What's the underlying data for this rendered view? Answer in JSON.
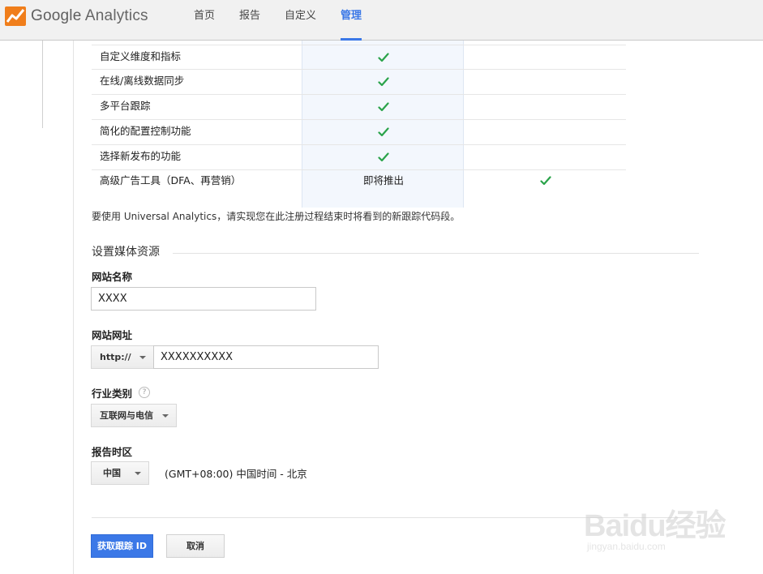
{
  "header": {
    "logo_google": "Google",
    "logo_product": "Analytics",
    "nav": [
      {
        "label": "首页",
        "active": false
      },
      {
        "label": "报告",
        "active": false
      },
      {
        "label": "自定义",
        "active": false
      },
      {
        "label": "管理",
        "active": true
      }
    ],
    "accent": "#3b78e7"
  },
  "features": {
    "rows": [
      {
        "label": "自定义维度和指标",
        "classic": "check",
        "ua": ""
      },
      {
        "label": "在线/离线数据同步",
        "classic": "check",
        "ua": ""
      },
      {
        "label": "多平台跟踪",
        "classic": "check",
        "ua": ""
      },
      {
        "label": "简化的配置控制功能",
        "classic": "check",
        "ua": ""
      },
      {
        "label": "选择新发布的功能",
        "classic": "check",
        "ua": ""
      },
      {
        "label": "高级广告工具（DFA、再营销）",
        "classic": "即将推出",
        "ua": "check"
      }
    ],
    "check_color": "#2aa34a",
    "notice": "要使用 Universal Analytics，请实现您在此注册过程结束时将看到的新跟踪代码段。"
  },
  "property": {
    "section_title": "设置媒体资源",
    "site_name": {
      "label": "网站名称",
      "value": "XXXX"
    },
    "site_url": {
      "label": "网站网址",
      "protocol": "http://",
      "value": "XXXXXXXXXX"
    },
    "industry": {
      "label": "行业类别",
      "help_icon": "question-icon",
      "help_glyph": "?",
      "selected": "互联网与电信"
    },
    "timezone": {
      "label": "报告时区",
      "country": "中国",
      "zone": "(GMT+08:00) 中国时间 - 北京"
    }
  },
  "actions": {
    "primary_label": "获取跟踪 ID",
    "cancel_label": "取消"
  },
  "watermark": {
    "main": "Baidu经验",
    "sub": "jingyan.baidu.com"
  }
}
